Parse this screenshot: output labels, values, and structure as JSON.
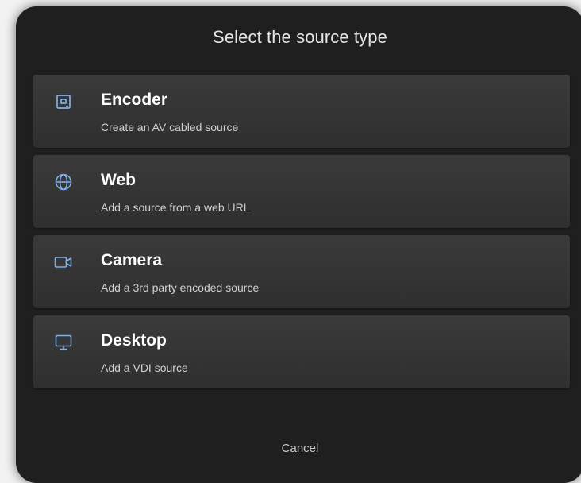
{
  "dialog": {
    "title": "Select the source type",
    "cancel_label": "Cancel",
    "accent_color": "#7fb0ea"
  },
  "options": [
    {
      "icon": "encoder-icon",
      "title": "Encoder",
      "description": "Create an AV cabled source"
    },
    {
      "icon": "globe-icon",
      "title": "Web",
      "description": "Add a source from a web URL"
    },
    {
      "icon": "camera-icon",
      "title": "Camera",
      "description": "Add a 3rd party encoded source"
    },
    {
      "icon": "monitor-icon",
      "title": "Desktop",
      "description": "Add a VDI source"
    }
  ]
}
